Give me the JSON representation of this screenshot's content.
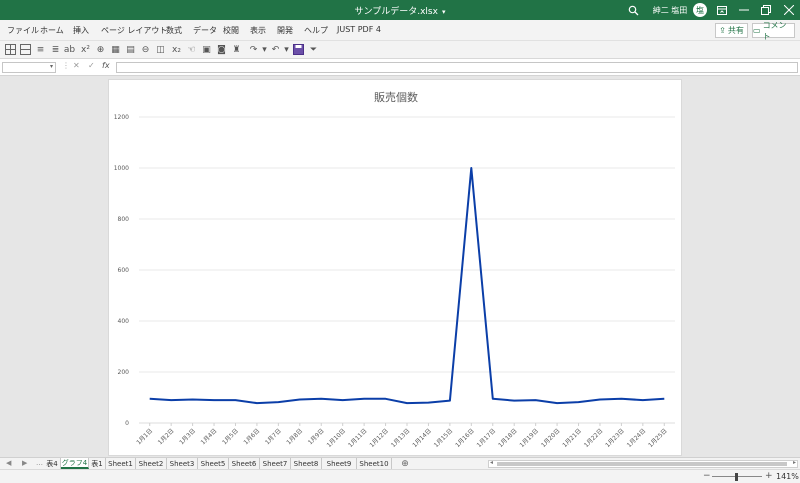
{
  "titlebar": {
    "title": "サンプルデータ.xlsx",
    "user": "紳二 塩田",
    "avatar_initial": "塩"
  },
  "menubar": {
    "items": [
      "ファイル",
      "ホーム",
      "挿入",
      "ページ レイアウト",
      "数式",
      "データ",
      "校閲",
      "表示",
      "開発",
      "ヘルプ",
      "JUST PDF 4"
    ],
    "share_label": "共有",
    "comment_label": "コメント"
  },
  "formulabar": {
    "name_box": "",
    "fx": "fx",
    "formula": ""
  },
  "sheet_tabs": [
    {
      "label": "表4",
      "active": false
    },
    {
      "label": "グラフ4",
      "active": true
    },
    {
      "label": "表1",
      "active": false
    },
    {
      "label": "Sheet1",
      "active": false
    },
    {
      "label": "Sheet2",
      "active": false
    },
    {
      "label": "Sheet3",
      "active": false
    },
    {
      "label": "Sheet5",
      "active": false
    },
    {
      "label": "Sheet6",
      "active": false
    },
    {
      "label": "Sheet7",
      "active": false
    },
    {
      "label": "Sheet8",
      "active": false
    },
    {
      "label": "Sheet9",
      "active": false
    },
    {
      "label": "Sheet10",
      "active": false
    }
  ],
  "status": {
    "zoom": "141%"
  },
  "colors": {
    "accent": "#217346",
    "series": "#0b3ea8",
    "grid": "#e3e3e3"
  },
  "chart_data": {
    "type": "line",
    "title": "販売個数",
    "xlabel": "",
    "ylabel": "",
    "ylim": [
      0,
      1200
    ],
    "yticks": [
      0,
      200,
      400,
      600,
      800,
      1000,
      1200
    ],
    "grid": true,
    "categories": [
      "1月1日",
      "1月2日",
      "1月3日",
      "1月4日",
      "1月5日",
      "1月6日",
      "1月7日",
      "1月8日",
      "1月9日",
      "1月10日",
      "1月11日",
      "1月12日",
      "1月13日",
      "1月14日",
      "1月15日",
      "1月16日",
      "1月17日",
      "1月18日",
      "1月19日",
      "1月20日",
      "1月21日",
      "1月22日",
      "1月23日",
      "1月24日",
      "1月25日"
    ],
    "series": [
      {
        "name": "",
        "values": [
          95,
          90,
          92,
          90,
          90,
          78,
          82,
          92,
          95,
          90,
          95,
          95,
          78,
          80,
          88,
          1000,
          95,
          88,
          90,
          78,
          82,
          92,
          95,
          90,
          95
        ]
      }
    ]
  }
}
